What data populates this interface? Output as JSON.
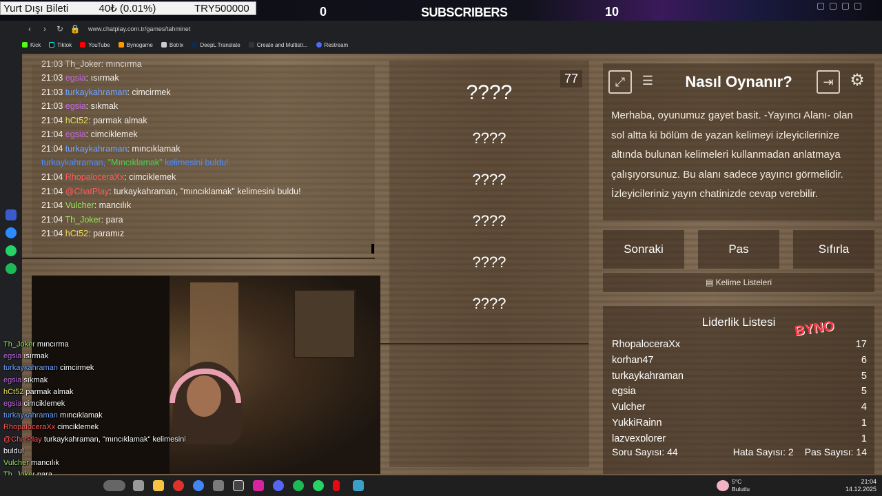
{
  "overlay": {
    "ticker_text": "Yurt Dışı Bileti",
    "ticker_value": "40₺ (0.01%)",
    "ticker_goal": "TRY500000",
    "subs_left": "0",
    "subs_label": "SUBSCRIBERS",
    "subs_right": "10"
  },
  "browser": {
    "url": "www.chatplay.com.tr/games/tahminet",
    "bookmarks": [
      "Kick",
      "Tiktok",
      "YouTube",
      "Bynogame",
      "Botrix",
      "DeepL Translate",
      "Create and Multistr...",
      "Restream"
    ]
  },
  "chat": {
    "lines": [
      {
        "time": "21:03",
        "user": "egsia",
        "msg": "ısırmak",
        "color": "nm-purple"
      },
      {
        "time": "21:03",
        "user": "turkaykahraman",
        "msg": "cimcirmek",
        "color": "nm-blue"
      },
      {
        "time": "21:03",
        "user": "egsia",
        "msg": "sıkmak",
        "color": "nm-purple"
      },
      {
        "time": "21:04",
        "user": "hCt52",
        "msg": "parmak almak",
        "color": "nm-yellow"
      },
      {
        "time": "21:04",
        "user": "egsia",
        "msg": "cimciklemek",
        "color": "nm-purple"
      },
      {
        "time": "21:04",
        "user": "turkaykahraman",
        "msg": "mıncıklamak",
        "color": "nm-blue"
      }
    ],
    "system_user": "turkaykahraman,",
    "system_word": "\"Mıncıklamak\"",
    "system_tail": "kelimesini buldu!.",
    "lines2": [
      {
        "time": "21:04",
        "user": "RhopaloceraXx",
        "msg": "cimciklemek",
        "color": "nm-red"
      },
      {
        "time": "21:04",
        "user": "@ChatPlay",
        "msg": "turkaykahraman, \"mıncıklamak\" kelimesini buldu!",
        "color": "nm-red"
      },
      {
        "time": "21:04",
        "user": "Vulcher",
        "msg": "mancılık",
        "color": "nm-green"
      },
      {
        "time": "21:04",
        "user": "Th_Joker",
        "msg": "para",
        "color": "nm-green"
      },
      {
        "time": "21:04",
        "user": "hCt52",
        "msg": "paramız",
        "color": "nm-yellow"
      }
    ],
    "top_partial": "21:03 Th_Joker: mıncırma"
  },
  "game": {
    "timer": "77",
    "words": [
      "????",
      "????",
      "????",
      "????",
      "????",
      "????"
    ]
  },
  "how": {
    "title": "Nasıl Oynanır?",
    "text": "Merhaba, oyunumuz gayet basit. -Yayıncı Alanı- olan sol altta ki bölüm de yazan kelimeyi izleyicilerinize altında bulunan kelimeleri kullanmadan anlatmaya çalışıyorsunuz. Bu alanı sadece yayıncı görmelidir. İzleyicileriniz yayın chatinizde cevap verebilir."
  },
  "buttons": {
    "next": "Sonraki",
    "pass": "Pas",
    "reset": "Sıfırla",
    "lists": "Kelime Listeleri"
  },
  "leaderboard": {
    "title": "Liderlik Listesi",
    "logo": "BYNO",
    "rows": [
      {
        "name": "RhopaloceraXx",
        "score": "17"
      },
      {
        "name": "korhan47",
        "score": "6"
      },
      {
        "name": "turkaykahraman",
        "score": "5"
      },
      {
        "name": "egsia",
        "score": "5"
      },
      {
        "name": "Vulcher",
        "score": "4"
      },
      {
        "name": "YukkiRainn",
        "score": "1"
      },
      {
        "name": "lazyexplorer",
        "score": "1"
      }
    ],
    "questions": "Soru Sayısı: 44",
    "errors": "Hata Sayısı: 2",
    "passes": "Pas Sayısı: 14"
  },
  "overlay_chat": [
    {
      "user": "Th_Joker",
      "msg": "mıncırma",
      "color": "#9be85b"
    },
    {
      "user": "egsia",
      "msg": "ısırmak",
      "color": "#c36be0"
    },
    {
      "user": "turkaykahraman",
      "msg": "cimcirmek",
      "color": "#6fa3ff"
    },
    {
      "user": "egsia",
      "msg": "sıkmak",
      "color": "#c36be0"
    },
    {
      "user": "hCt52",
      "msg": "parmak almak",
      "color": "#e8e15b"
    },
    {
      "user": "egsia",
      "msg": "cimciklemek",
      "color": "#c36be0"
    },
    {
      "user": "turkaykahraman",
      "msg": "mıncıklamak",
      "color": "#6fa3ff"
    },
    {
      "user": "RhopaloceraXx",
      "msg": "cimciklemek",
      "color": "#ff5c5c"
    },
    {
      "user": "@ChatPlay",
      "msg": "turkaykahraman, \"mıncıklamak\" kelimesini",
      "color": "#ff5c5c"
    },
    {
      "user": "",
      "msg": "buldu!",
      "color": "#fff"
    },
    {
      "user": "Vulcher",
      "msg": "mancılık",
      "color": "#9be85b"
    },
    {
      "user": "Th_Joker",
      "msg": "para",
      "color": "#9be85b"
    },
    {
      "user": "hCt52",
      "msg": "paramız",
      "color": "#e8e15b"
    }
  ],
  "taskbar": {
    "temp": "5°C",
    "weather": "Bulutlu",
    "time": "21:04",
    "date": "14.12.2025"
  }
}
